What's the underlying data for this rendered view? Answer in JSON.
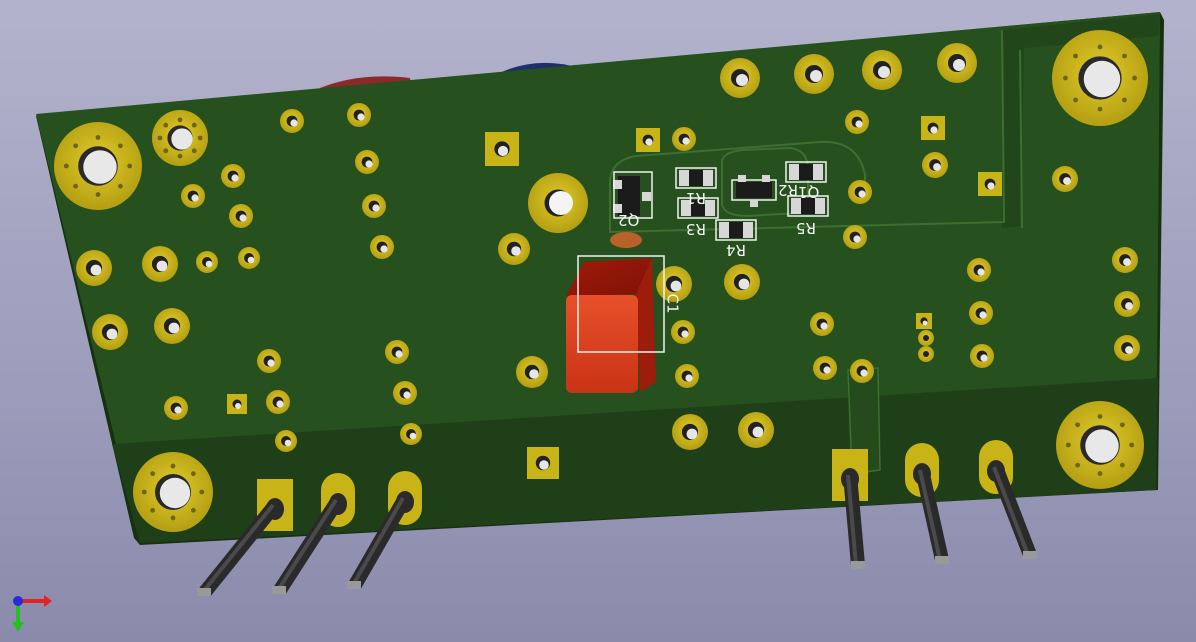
{
  "viewer": {
    "background_top": "#b3b3cd",
    "background_bottom": "#8a8aab",
    "axis_indicator": {
      "x_color": "#e52222",
      "y_color": "#22c022",
      "z_color": "#2a2ad8"
    }
  },
  "board": {
    "solder_mask_color": "#26501d",
    "copper_fill_color": "#23431b",
    "pad_color": "#c9b418",
    "hole_color": "#eeeeee",
    "pin_color": "#3a3a3a",
    "capacitor_color": "#d2381a",
    "designators": [
      {
        "key": "r1",
        "text": "R1",
        "icon": "resistor-smd-icon"
      },
      {
        "key": "r2",
        "text": "R2",
        "icon": "resistor-smd-icon"
      },
      {
        "key": "r3",
        "text": "R3",
        "icon": "resistor-smd-icon"
      },
      {
        "key": "r4",
        "text": "R4",
        "icon": "resistor-smd-icon"
      },
      {
        "key": "r5",
        "text": "R5",
        "icon": "resistor-smd-icon"
      },
      {
        "key": "q1",
        "text": "Q1",
        "icon": "transistor-sot23-icon"
      },
      {
        "key": "q2",
        "text": "Q2",
        "icon": "transistor-sot23-icon"
      },
      {
        "key": "c1",
        "text": "C1",
        "icon": "capacitor-box-icon"
      }
    ]
  }
}
